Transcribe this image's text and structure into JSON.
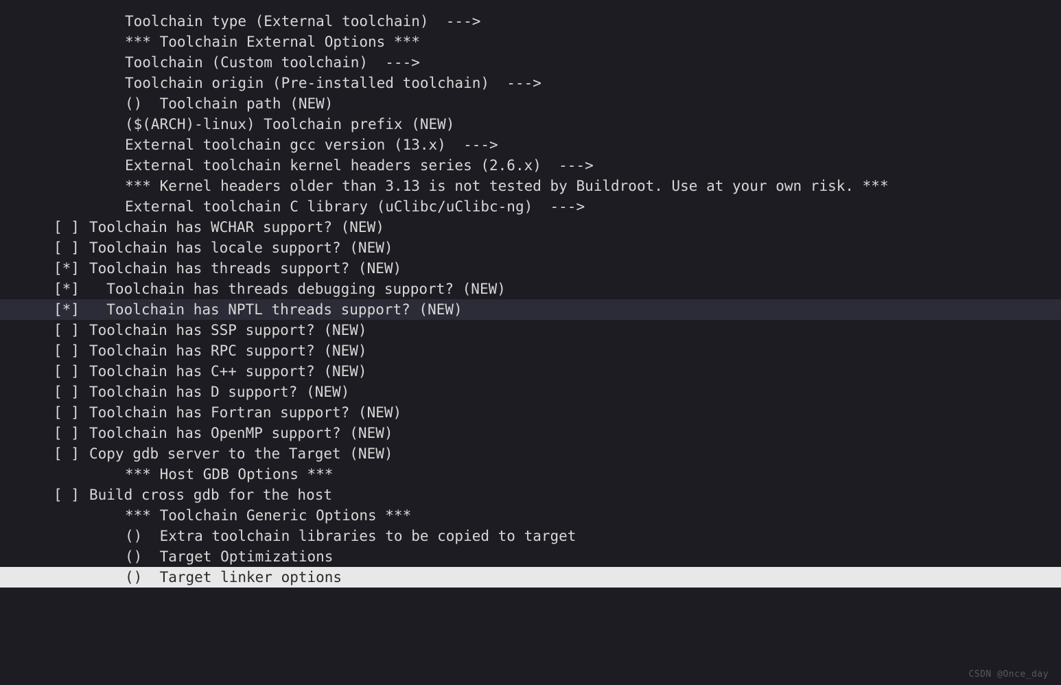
{
  "colors": {
    "bg": "#1c1c22",
    "fg": "#d8d8d8",
    "highlight_bg": "#2c2c38",
    "white_bg": "#e8e8e8",
    "white_fg": "#2a2a2a"
  },
  "watermark": "CSDN @Once_day",
  "separator_menu": "  --->",
  "separator_header_stars": "***",
  "lines": [
    {
      "prefix": "",
      "indent": 1,
      "text": "Toolchain type (External toolchain)  --->"
    },
    {
      "prefix": "",
      "indent": 1,
      "text": "*** Toolchain External Options ***"
    },
    {
      "prefix": "",
      "indent": 1,
      "text": "Toolchain (Custom toolchain)  --->"
    },
    {
      "prefix": "",
      "indent": 1,
      "text": "Toolchain origin (Pre-installed toolchain)  --->"
    },
    {
      "prefix": "",
      "indent": 1,
      "text": "()  Toolchain path (NEW)"
    },
    {
      "prefix": "",
      "indent": 1,
      "text": "($(ARCH)-linux) Toolchain prefix (NEW)"
    },
    {
      "prefix": "",
      "indent": 1,
      "text": "External toolchain gcc version (13.x)  --->"
    },
    {
      "prefix": "",
      "indent": 1,
      "text": "External toolchain kernel headers series (2.6.x)  --->"
    },
    {
      "prefix": "",
      "indent": 1,
      "text": "*** Kernel headers older than 3.13 is not tested by Buildroot. Use at your own risk. ***"
    },
    {
      "prefix": "",
      "indent": 1,
      "text": "External toolchain C library (uClibc/uClibc-ng)  --->"
    },
    {
      "prefix": "[ ]",
      "indent": 0,
      "text": "Toolchain has WCHAR support? (NEW)"
    },
    {
      "prefix": "[ ]",
      "indent": 0,
      "text": "Toolchain has locale support? (NEW)"
    },
    {
      "prefix": "[*]",
      "indent": 0,
      "text": "Toolchain has threads support? (NEW)"
    },
    {
      "prefix": "[*]",
      "indent": 0,
      "text": "  Toolchain has threads debugging support? (NEW)"
    },
    {
      "prefix": "[*]",
      "indent": 0,
      "text": "  Toolchain has NPTL threads support? (NEW)",
      "highlight": true
    },
    {
      "prefix": "[ ]",
      "indent": 0,
      "text": "Toolchain has SSP support? (NEW)"
    },
    {
      "prefix": "[ ]",
      "indent": 0,
      "text": "Toolchain has RPC support? (NEW)"
    },
    {
      "prefix": "[ ]",
      "indent": 0,
      "text": "Toolchain has C++ support? (NEW)"
    },
    {
      "prefix": "[ ]",
      "indent": 0,
      "text": "Toolchain has D support? (NEW)"
    },
    {
      "prefix": "[ ]",
      "indent": 0,
      "text": "Toolchain has Fortran support? (NEW)"
    },
    {
      "prefix": "[ ]",
      "indent": 0,
      "text": "Toolchain has OpenMP support? (NEW)"
    },
    {
      "prefix": "[ ]",
      "indent": 0,
      "text": "Copy gdb server to the Target (NEW)"
    },
    {
      "prefix": "",
      "indent": 1,
      "text": "*** Host GDB Options ***"
    },
    {
      "prefix": "[ ]",
      "indent": 0,
      "text": "Build cross gdb for the host"
    },
    {
      "prefix": "",
      "indent": 1,
      "text": "*** Toolchain Generic Options ***"
    },
    {
      "prefix": "",
      "indent": 1,
      "text": "()  Extra toolchain libraries to be copied to target"
    },
    {
      "prefix": "",
      "indent": 1,
      "text": "()  Target Optimizations"
    },
    {
      "prefix": "",
      "indent": 1,
      "text": "()  Target linker options",
      "whitebar": true
    }
  ]
}
